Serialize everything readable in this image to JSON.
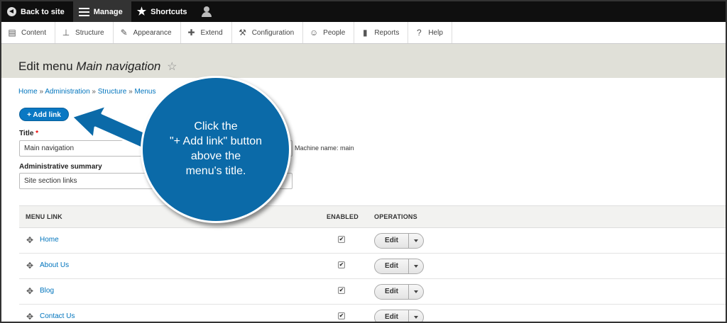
{
  "toolbar": {
    "back": "Back to site",
    "manage": "Manage",
    "shortcuts": "Shortcuts"
  },
  "admin_menu": [
    {
      "label": "Content",
      "icon": "content-icon"
    },
    {
      "label": "Structure",
      "icon": "structure-icon"
    },
    {
      "label": "Appearance",
      "icon": "appearance-icon"
    },
    {
      "label": "Extend",
      "icon": "extend-icon"
    },
    {
      "label": "Configuration",
      "icon": "configuration-icon"
    },
    {
      "label": "People",
      "icon": "people-icon"
    },
    {
      "label": "Reports",
      "icon": "reports-icon"
    },
    {
      "label": "Help",
      "icon": "help-icon"
    }
  ],
  "page": {
    "title_prefix": "Edit menu",
    "title_name": "Main navigation"
  },
  "breadcrumb": [
    "Home",
    "Administration",
    "Structure",
    "Menus"
  ],
  "add_link_label": "+ Add link",
  "form": {
    "title_label": "Title",
    "title_value": "Main navigation",
    "machine_name": "Machine name: main",
    "summary_label": "Administrative summary",
    "summary_value": "Site section links"
  },
  "table": {
    "headers": [
      "MENU LINK",
      "ENABLED",
      "OPERATIONS"
    ],
    "rows": [
      {
        "link": "Home",
        "enabled": true,
        "op": "Edit"
      },
      {
        "link": "About Us",
        "enabled": true,
        "op": "Edit"
      },
      {
        "link": "Blog",
        "enabled": true,
        "op": "Edit"
      },
      {
        "link": "Contact Us",
        "enabled": true,
        "op": "Edit"
      }
    ]
  },
  "callout": {
    "text": "Click the\n\"+ Add link\" button\nabove the\nmenu's title.",
    "color": "#0b6aa8"
  }
}
